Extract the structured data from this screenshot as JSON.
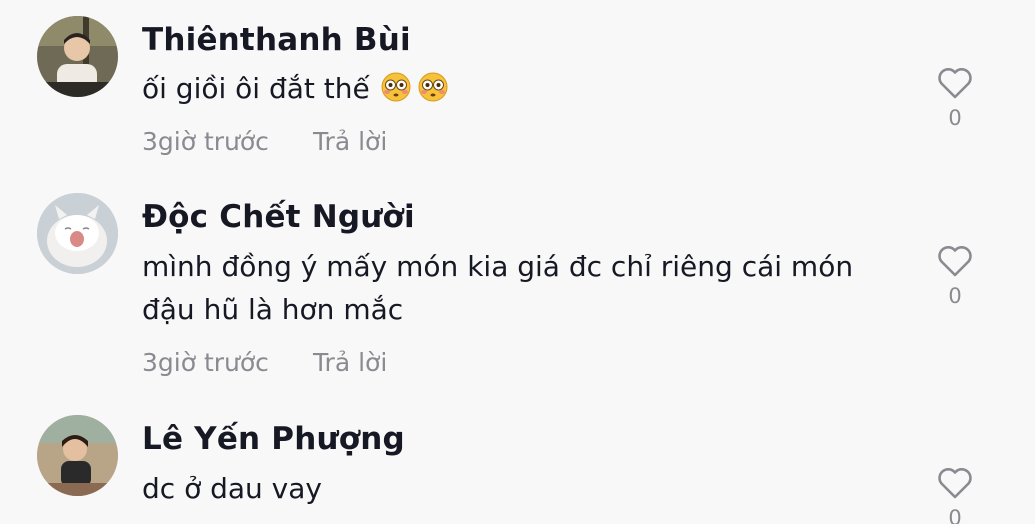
{
  "comments": [
    {
      "username": "Thiênthanh Bùi",
      "text": "ối giồi ôi đắt thế",
      "emoji": "flushed-face-emoji",
      "time": "3giờ trước",
      "reply_label": "Trả lời",
      "likes": "0"
    },
    {
      "username": "Độc Chết Người",
      "text": "mình đồng ý mấy món kia giá đc chỉ riêng cái món đậu hũ là hơn mắc",
      "time": "3giờ trước",
      "reply_label": "Trả lời",
      "likes": "0"
    },
    {
      "username": "Lê Yến Phượng",
      "text": "dc ở dau vay",
      "likes": "0"
    }
  ],
  "icons": {
    "like": "heart-outline-icon"
  },
  "colors": {
    "background": "#f8f8f8",
    "text_primary": "#161823",
    "text_secondary": "#8a8b91"
  }
}
